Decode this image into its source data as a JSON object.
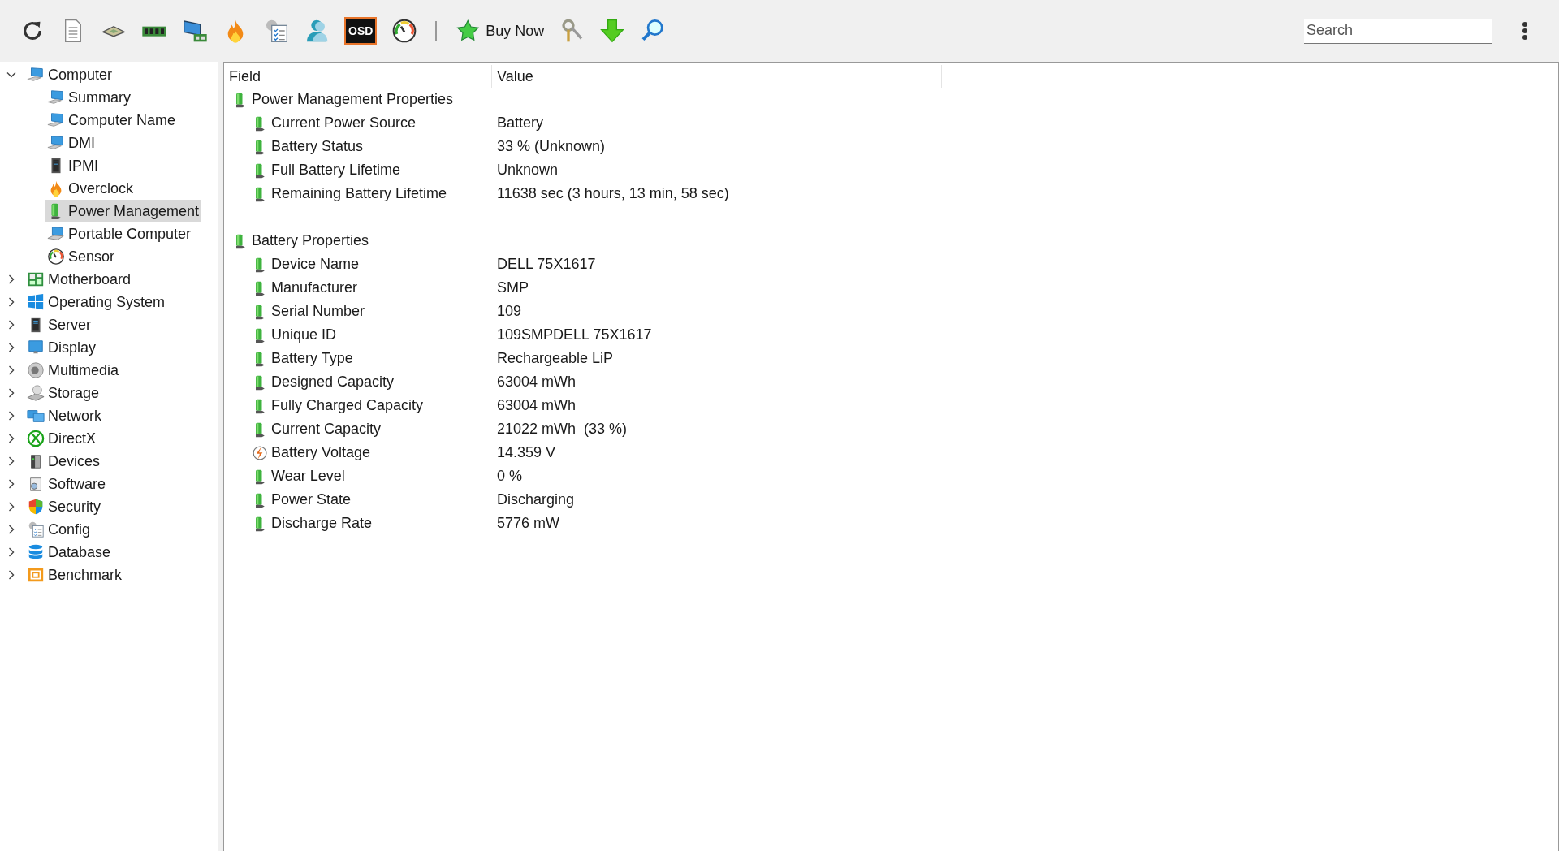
{
  "toolbar": {
    "buttons": [
      {
        "kind": "refresh"
      },
      {
        "kind": "report"
      },
      {
        "kind": "cpu"
      },
      {
        "kind": "memory"
      },
      {
        "kind": "netcard"
      },
      {
        "kind": "flame"
      },
      {
        "kind": "config"
      },
      {
        "kind": "user"
      },
      {
        "kind": "osd",
        "label": "OSD"
      },
      {
        "kind": "gauge"
      },
      {
        "kind": "separator"
      },
      {
        "kind": "buy",
        "label": "Buy Now"
      },
      {
        "kind": "keys"
      },
      {
        "kind": "download"
      },
      {
        "kind": "search"
      }
    ]
  },
  "search": {
    "placeholder": "Search"
  },
  "tree": [
    {
      "label": "Computer",
      "kind": "computer",
      "expanded": true,
      "selected": false,
      "children": [
        {
          "label": "Summary",
          "kind": "computer",
          "selected": false
        },
        {
          "label": "Computer Name",
          "kind": "computer",
          "selected": false
        },
        {
          "label": "DMI",
          "kind": "computer",
          "selected": false
        },
        {
          "label": "IPMI",
          "kind": "server",
          "selected": false
        },
        {
          "label": "Overclock",
          "kind": "flame",
          "selected": false
        },
        {
          "label": "Power Management",
          "kind": "battery",
          "selected": true
        },
        {
          "label": "Portable Computer",
          "kind": "laptop",
          "selected": false
        },
        {
          "label": "Sensor",
          "kind": "gauge",
          "selected": false
        }
      ]
    },
    {
      "label": "Motherboard",
      "kind": "motherboard",
      "expanded": false,
      "selected": false
    },
    {
      "label": "Operating System",
      "kind": "windows",
      "expanded": false,
      "selected": false
    },
    {
      "label": "Server",
      "kind": "server",
      "expanded": false,
      "selected": false
    },
    {
      "label": "Display",
      "kind": "display",
      "expanded": false,
      "selected": false
    },
    {
      "label": "Multimedia",
      "kind": "speaker",
      "expanded": false,
      "selected": false
    },
    {
      "label": "Storage",
      "kind": "storage",
      "expanded": false,
      "selected": false
    },
    {
      "label": "Network",
      "kind": "network",
      "expanded": false,
      "selected": false
    },
    {
      "label": "DirectX",
      "kind": "xbox",
      "expanded": false,
      "selected": false
    },
    {
      "label": "Devices",
      "kind": "devices",
      "expanded": false,
      "selected": false
    },
    {
      "label": "Software",
      "kind": "software",
      "expanded": false,
      "selected": false
    },
    {
      "label": "Security",
      "kind": "shield",
      "expanded": false,
      "selected": false
    },
    {
      "label": "Config",
      "kind": "config",
      "expanded": false,
      "selected": false
    },
    {
      "label": "Database",
      "kind": "database",
      "expanded": false,
      "selected": false
    },
    {
      "label": "Benchmark",
      "kind": "benchmark",
      "expanded": false,
      "selected": false
    }
  ],
  "table": {
    "columns": [
      "Field",
      "Value"
    ],
    "sections": [
      {
        "label": "Power Management Properties",
        "kind": "battery",
        "rows": [
          {
            "field": "Current Power Source",
            "value": "Battery",
            "kind": "battery"
          },
          {
            "field": "Battery Status",
            "value": "33 % (Unknown)",
            "kind": "battery"
          },
          {
            "field": "Full Battery Lifetime",
            "value": "Unknown",
            "kind": "battery"
          },
          {
            "field": "Remaining Battery Lifetime",
            "value": "11638 sec (3 hours, 13 min, 58 sec)",
            "kind": "battery"
          }
        ]
      },
      {
        "label": "Battery Properties",
        "kind": "battery",
        "rows": [
          {
            "field": "Device Name",
            "value": "DELL 75X1617",
            "kind": "battery"
          },
          {
            "field": "Manufacturer",
            "value": "SMP",
            "kind": "battery"
          },
          {
            "field": "Serial Number",
            "value": "109",
            "kind": "battery"
          },
          {
            "field": "Unique ID",
            "value": "109SMPDELL 75X1617",
            "kind": "battery"
          },
          {
            "field": "Battery Type",
            "value": "Rechargeable LiP",
            "kind": "battery"
          },
          {
            "field": "Designed Capacity",
            "value": "63004 mWh",
            "kind": "battery"
          },
          {
            "field": "Fully Charged Capacity",
            "value": "63004 mWh",
            "kind": "battery"
          },
          {
            "field": "Current Capacity",
            "value": "21022 mWh  (33 %)",
            "kind": "battery"
          },
          {
            "field": "Battery Voltage",
            "value": "14.359 V",
            "kind": "voltage"
          },
          {
            "field": "Wear Level",
            "value": "0 %",
            "kind": "battery"
          },
          {
            "field": "Power State",
            "value": "Discharging",
            "kind": "battery"
          },
          {
            "field": "Discharge Rate",
            "value": "5776 mW",
            "kind": "battery"
          }
        ]
      }
    ]
  }
}
